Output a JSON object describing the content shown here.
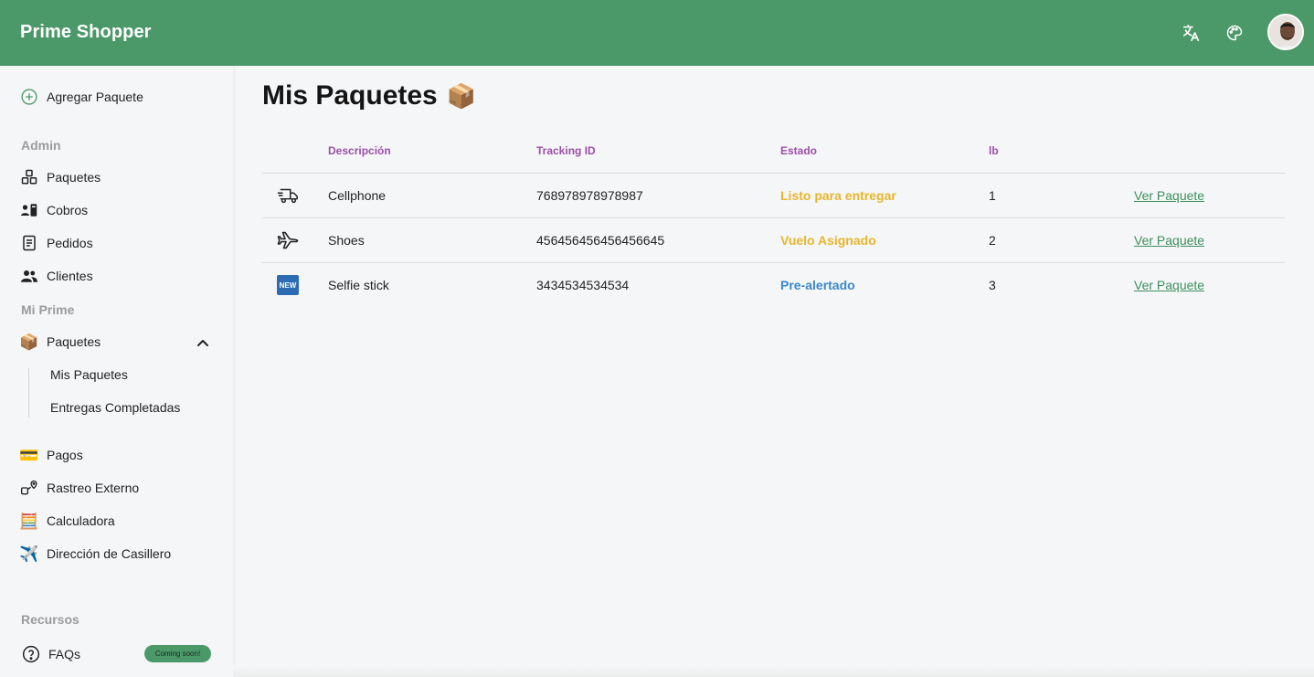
{
  "app": {
    "title": "Prime Shopper"
  },
  "header": {
    "translate_icon": "translate-icon",
    "palette_icon": "palette-icon",
    "avatar": "user-avatar"
  },
  "sidebar": {
    "add_package": "Agregar Paquete",
    "sections": {
      "admin": "Admin",
      "mi_prime": "Mi Prime",
      "recursos": "Recursos"
    },
    "admin_items": [
      {
        "label": "Paquetes",
        "icon": "boxes-icon"
      },
      {
        "label": "Cobros",
        "icon": "id-card-icon"
      },
      {
        "label": "Pedidos",
        "icon": "document-icon"
      },
      {
        "label": "Clientes",
        "icon": "users-icon"
      }
    ],
    "mi_prime_items": {
      "paquetes": "Paquetes",
      "sub": [
        "Mis Paquetes",
        "Entregas Completadas"
      ],
      "pagos": "Pagos",
      "rastreo": "Rastreo Externo",
      "calculadora": "Calculadora",
      "direccion": "Dirección de Casillero"
    },
    "faqs": "FAQs",
    "coming_soon": "Coming soon!"
  },
  "main": {
    "title": "Mis Paquetes",
    "title_emoji": "📦",
    "columns": [
      "Descripción",
      "Tracking ID",
      "Estado",
      "lb"
    ],
    "rows": [
      {
        "icon": "delivery-truck-icon",
        "description": "Cellphone",
        "tracking": "768978978978987",
        "status": "Listo para entregar",
        "status_color": "#e8b52a",
        "lb": "1",
        "action": "Ver Paquete"
      },
      {
        "icon": "airplane-icon",
        "description": "Shoes",
        "tracking": "456456456456456645",
        "status": "Vuelo Asignado",
        "status_color": "#e8b52a",
        "lb": "2",
        "action": "Ver Paquete"
      },
      {
        "icon": "new-badge-icon",
        "new_label": "NEW",
        "description": "Selfie stick",
        "tracking": "3434534534534",
        "status": "Pre-alertado",
        "status_color": "#3a88c9",
        "lb": "3",
        "action": "Ver Paquete"
      }
    ]
  },
  "colors": {
    "brand": "#4b9868",
    "header_text": "#9a4fa8",
    "link": "#3f8f5e"
  }
}
